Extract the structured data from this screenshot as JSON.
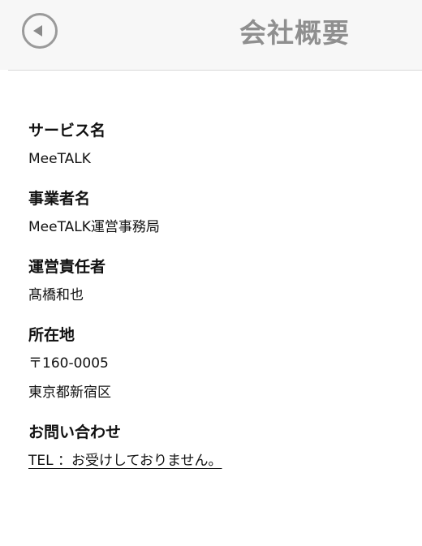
{
  "header": {
    "title": "会社概要",
    "back_icon": "back-arrow-circle-icon"
  },
  "sections": [
    {
      "heading": "サービス名",
      "lines": [
        "MeeTALK"
      ]
    },
    {
      "heading": "事業者名",
      "lines": [
        "MeeTALK運営事務局"
      ]
    },
    {
      "heading": "運営責任者",
      "lines": [
        "髙橋和也"
      ]
    },
    {
      "heading": "所在地",
      "lines": [
        "〒160-0005",
        "東京都新宿区"
      ]
    },
    {
      "heading": "お問い合わせ",
      "lines": [
        "TEL ：お受けしておりません。"
      ]
    }
  ],
  "colors": {
    "header_bg": "#f7f7f7",
    "title": "#8f8f8f",
    "text": "#111111"
  }
}
